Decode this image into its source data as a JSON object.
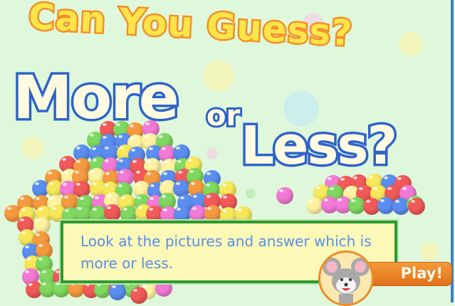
{
  "title": {
    "line1": "Can You Guess?",
    "line2": "More",
    "line3": "or",
    "line4": "Less?"
  },
  "instructions": "Look at the pictures and answer which is more or less.",
  "play_button": "Play!",
  "mascot": "mouse-mascot-icon",
  "colors": {
    "background": "#dff8dc",
    "ball_colors": [
      "#f25a5a",
      "#5b8ef0",
      "#f7e85a",
      "#7fd85f",
      "#f59a40",
      "#f27ad6",
      "#fff2a0"
    ],
    "text": "#5a8fe6",
    "box_border": "#2e9a2e",
    "play": "#e8801f"
  }
}
